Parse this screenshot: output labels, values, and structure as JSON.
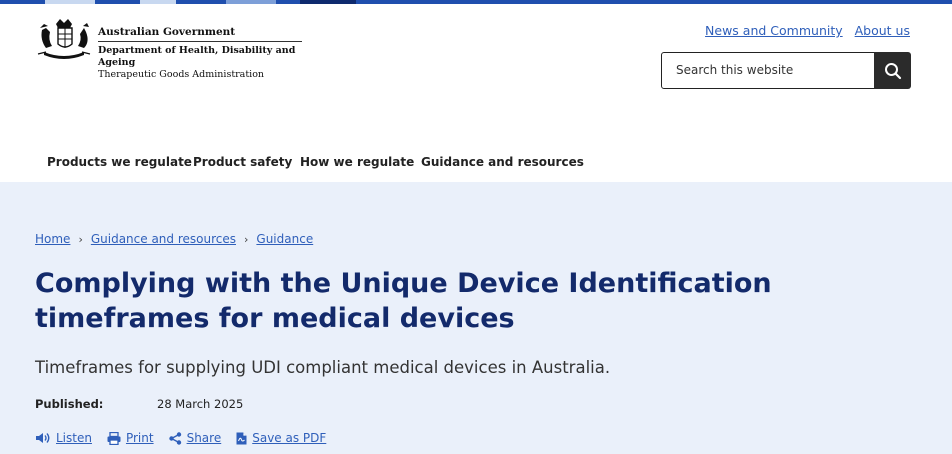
{
  "brand": {
    "government": "Australian Government",
    "department": "Department of Health, Disability and Ageing",
    "agency": "Therapeutic Goods Administration"
  },
  "utility_links": [
    {
      "label": "News and Community"
    },
    {
      "label": "About us"
    }
  ],
  "search": {
    "placeholder": "Search this website",
    "button_icon": "search-icon"
  },
  "nav": {
    "items": [
      {
        "label": "Products we regulate",
        "active": false
      },
      {
        "label": "Product safety",
        "active": false
      },
      {
        "label": "How we regulate",
        "active": false
      },
      {
        "label": "Guidance and resources",
        "active": true
      }
    ]
  },
  "breadcrumb": [
    "Home",
    "Guidance and resources",
    "Guidance"
  ],
  "page": {
    "title": "Complying with the Unique Device Identification timeframes for medical devices",
    "subtitle": "Timeframes for supplying UDI compliant medical devices in Australia.",
    "published_label": "Published:",
    "published_date": "28 March 2025"
  },
  "actions": [
    {
      "label": "Listen",
      "icon": "speaker-icon"
    },
    {
      "label": "Print",
      "icon": "printer-icon"
    },
    {
      "label": "Share",
      "icon": "share-icon"
    },
    {
      "label": "Save as PDF",
      "icon": "pdf-file-icon"
    }
  ],
  "colors": {
    "brand_blue": "#1f4fae",
    "title_navy": "#132a6b",
    "link_blue": "#2f5fba",
    "hero_bg": "#eaf0fa",
    "nav_underline": "#b9cbe6"
  }
}
